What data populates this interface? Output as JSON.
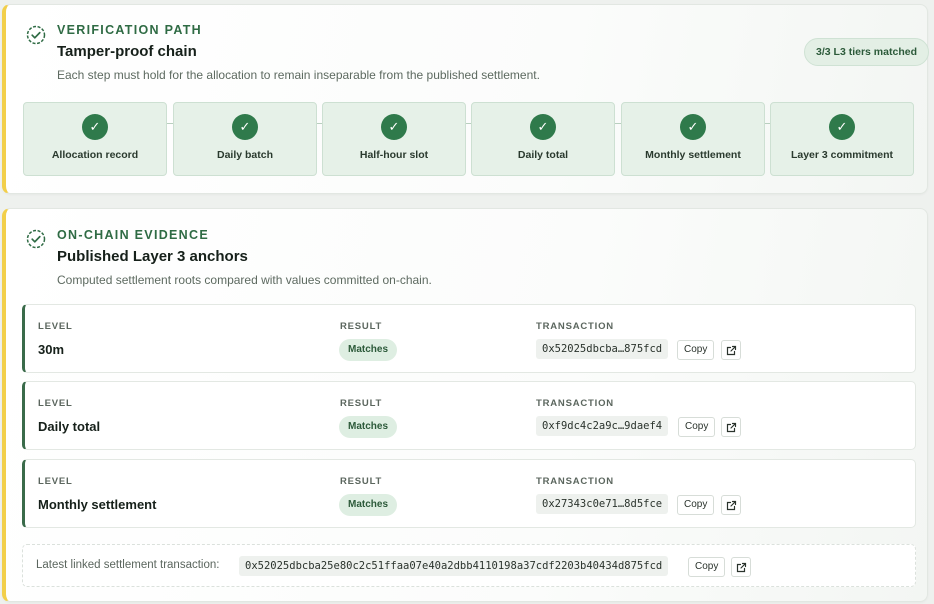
{
  "verification": {
    "eyebrow": "VERIFICATION PATH",
    "title": "Tamper-proof chain",
    "subtitle": "Each step must hold for the allocation to remain inseparable from the published settlement.",
    "badge": "3/3 L3 tiers matched",
    "steps": [
      {
        "label": "Allocation record",
        "status": "check-icon"
      },
      {
        "label": "Daily batch",
        "status": "check-icon"
      },
      {
        "label": "Half-hour slot",
        "status": "check-icon"
      },
      {
        "label": "Daily total",
        "status": "check-icon"
      },
      {
        "label": "Monthly settlement",
        "status": "check-icon"
      },
      {
        "label": "Layer 3 commitment",
        "status": "check-icon"
      }
    ]
  },
  "evidence": {
    "eyebrow": "ON-CHAIN EVIDENCE",
    "title": "Published Layer 3 anchors",
    "subtitle": "Computed settlement roots compared with values committed on-chain.",
    "columns": {
      "level": "LEVEL",
      "result": "RESULT",
      "transaction": "TRANSACTION"
    },
    "rows": [
      {
        "level": "30m",
        "result": "Matches",
        "tx": "0x52025dbcba…875fcd",
        "copy": "Copy"
      },
      {
        "level": "Daily total",
        "result": "Matches",
        "tx": "0xf9dc4c2a9c…9daef4",
        "copy": "Copy"
      },
      {
        "level": "Monthly settlement",
        "result": "Matches",
        "tx": "0x27343c0e71…8d5fce",
        "copy": "Copy"
      }
    ],
    "latest": {
      "label": "Latest linked settlement transaction:",
      "tx": "0x52025dbcba25e80c2c51ffaa07e40a2dbb4110198a37cdf2203b40434d875fcd",
      "copy": "Copy"
    }
  },
  "colors": {
    "accent": "#2f7a4b",
    "highlight_border": "#f2cf4a",
    "row_border": "#3a6b4a"
  }
}
